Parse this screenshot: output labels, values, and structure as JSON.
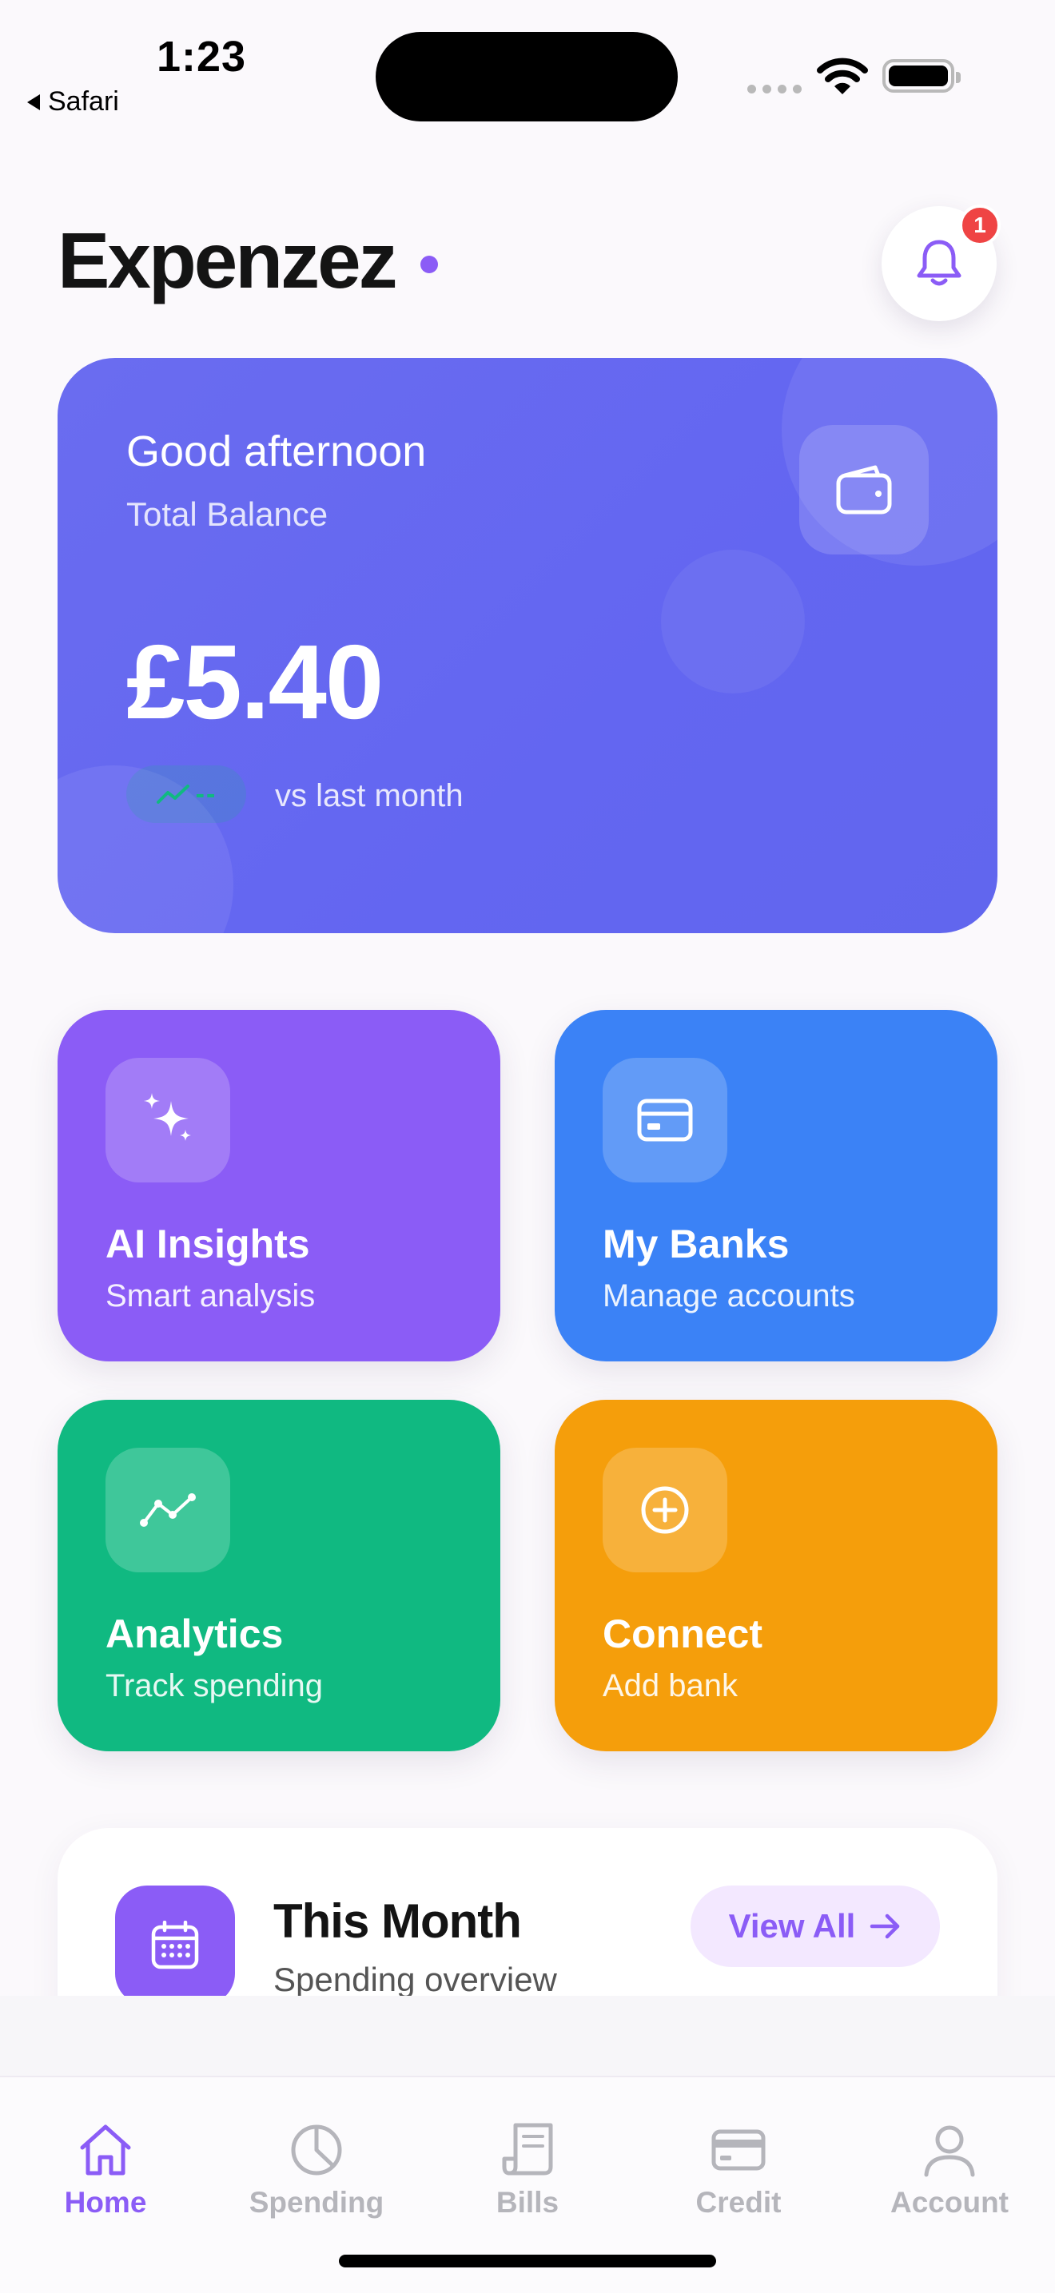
{
  "status_bar": {
    "time": "1:23",
    "back_app": "Safari"
  },
  "header": {
    "app_name": "Expenzez",
    "notification_count": "1"
  },
  "balance_card": {
    "greeting": "Good afternoon",
    "label": "Total Balance",
    "amount": "£5.40",
    "trend_value": "--",
    "comparison": "vs last month"
  },
  "quick_actions": [
    {
      "title": "AI Insights",
      "subtitle": "Smart analysis",
      "icon": "sparkles-icon",
      "color": "#8b5cf6"
    },
    {
      "title": "My Banks",
      "subtitle": "Manage accounts",
      "icon": "credit-card-icon",
      "color": "#3b82f6"
    },
    {
      "title": "Analytics",
      "subtitle": "Track spending",
      "icon": "trend-line-icon",
      "color": "#10b981"
    },
    {
      "title": "Connect",
      "subtitle": "Add bank",
      "icon": "plus-circle-icon",
      "color": "#f59e0b"
    }
  ],
  "month_section": {
    "title": "This Month",
    "subtitle": "Spending overview",
    "button": "View All"
  },
  "tab_bar": [
    {
      "label": "Home",
      "icon": "home-icon",
      "active": true
    },
    {
      "label": "Spending",
      "icon": "pie-chart-icon",
      "active": false
    },
    {
      "label": "Bills",
      "icon": "receipt-icon",
      "active": false
    },
    {
      "label": "Credit",
      "icon": "credit-card-icon",
      "active": false
    },
    {
      "label": "Account",
      "icon": "user-icon",
      "active": false
    }
  ],
  "colors": {
    "accent": "#8b5cf6",
    "balance_card": "#6366f1",
    "badge": "#ef4444",
    "inactive_tab": "#b5b5bb"
  }
}
